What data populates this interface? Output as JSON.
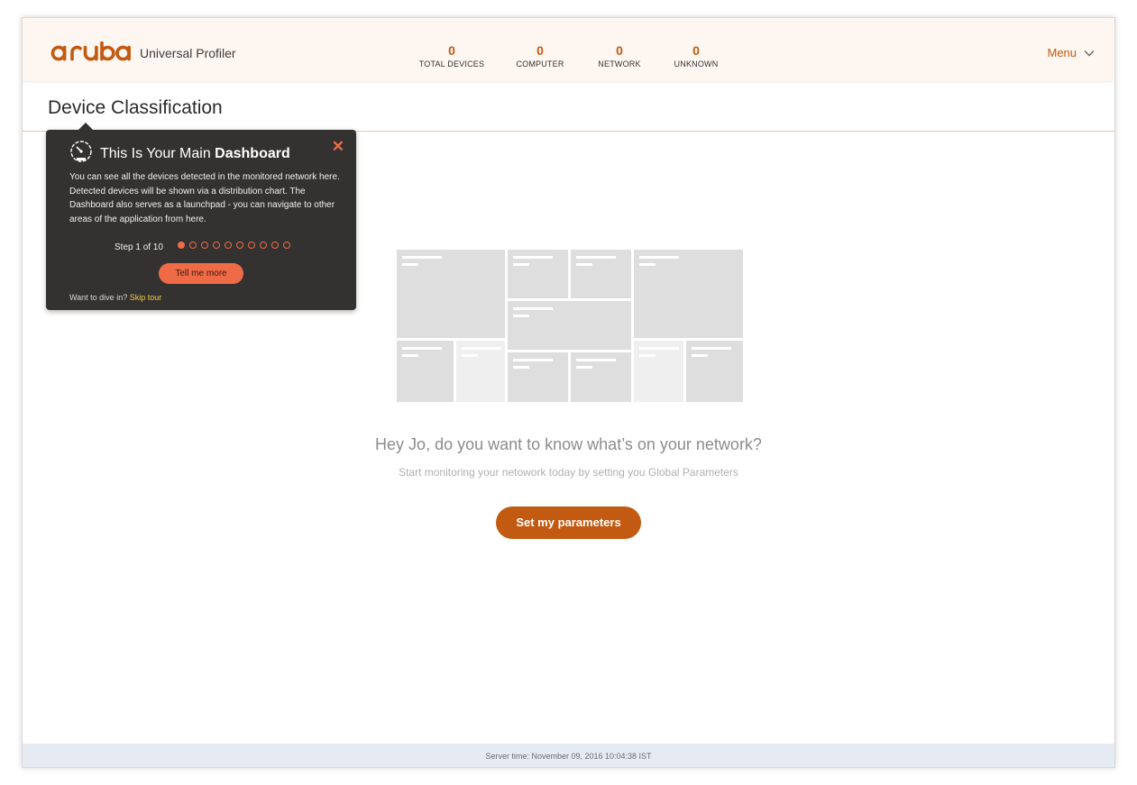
{
  "header": {
    "logo_text": "aruba",
    "product_name": "Universal Profiler",
    "stats": [
      {
        "value": "0",
        "label": "TOTAL DEVICES"
      },
      {
        "value": "0",
        "label": "COMPUTER"
      },
      {
        "value": "0",
        "label": "NETWORK"
      },
      {
        "value": "0",
        "label": "UNKNOWN"
      }
    ],
    "menu_label": "Menu"
  },
  "page": {
    "title": "Device Classification"
  },
  "tour": {
    "title_prefix": "This Is Your Main ",
    "title_bold": "Dashboard",
    "body": "You can see all the devices detected in the monitored network here. Detected devices will be shown via a distribution chart. The Dashboard also serves as a launchpad - you can navigate to other areas of the application from here.",
    "step_text": "Step 1 of 10",
    "current_step": 1,
    "total_steps": 10,
    "button_label": "Tell me more",
    "footer_prefix": "Want to dive in?",
    "skip_label": "Skip tour"
  },
  "empty_state": {
    "headline": "Hey Jo, do you want to know what’s on your network?",
    "subtext": "Start monitoring your netowork today by setting you Global Parameters",
    "cta_label": "Set my parameters"
  },
  "footer": {
    "server_time": "Server time: November 09, 2016 10:04:38 IST"
  },
  "colors": {
    "brand_orange": "#c25a11",
    "tour_accent": "#ef6b48",
    "tour_bg": "#333231",
    "skip_link": "#f2c94c"
  }
}
